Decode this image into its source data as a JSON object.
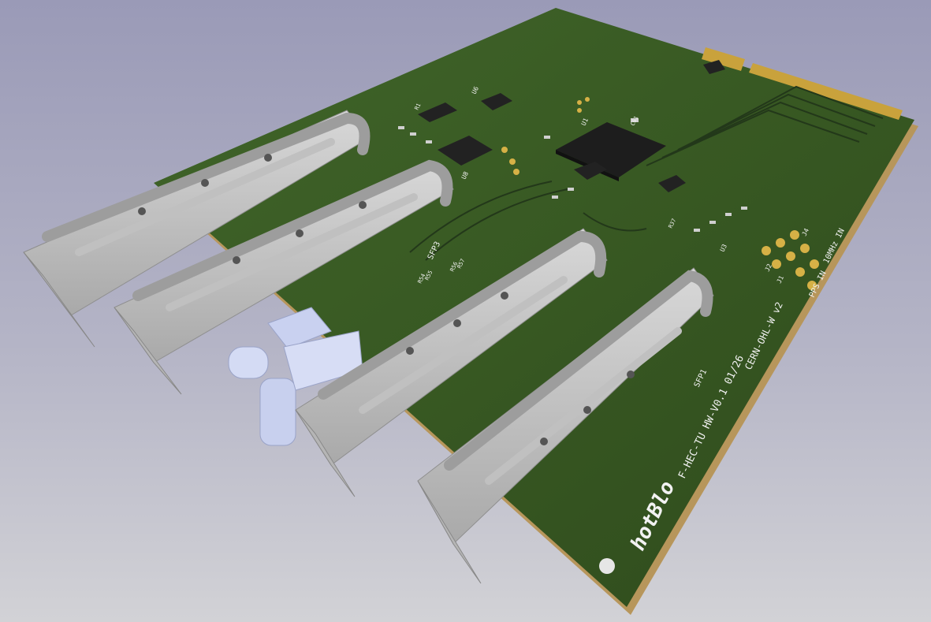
{
  "board": {
    "title_text": "F-HEC-TU HW-V0.1 01/26",
    "license_text": "CERN-OHL-W v2",
    "logo_text": "hotBlo",
    "pps_label": "PPS IN",
    "clk_label": "10MHz IN",
    "colors": {
      "pcb": "#3a5a24",
      "pcb_dark": "#2b4419",
      "pcb_edge": "#c9a86b",
      "gold": "#d8b44a",
      "cage": "#c8c8c8",
      "cage_shadow": "#9a9a9a",
      "optic": "#c8d0f0"
    }
  },
  "labels": {
    "sfp1": "SFP1",
    "sfp3": "SFP3",
    "j1": "J1",
    "j2": "J2",
    "j4": "J4",
    "u1": "U1",
    "u3": "U3",
    "u6": "U6",
    "u8": "U8",
    "r54": "R54",
    "r55": "R55",
    "r56": "R56",
    "r57": "R57",
    "r37": "R37",
    "c61": "C61",
    "r1": "R1"
  }
}
